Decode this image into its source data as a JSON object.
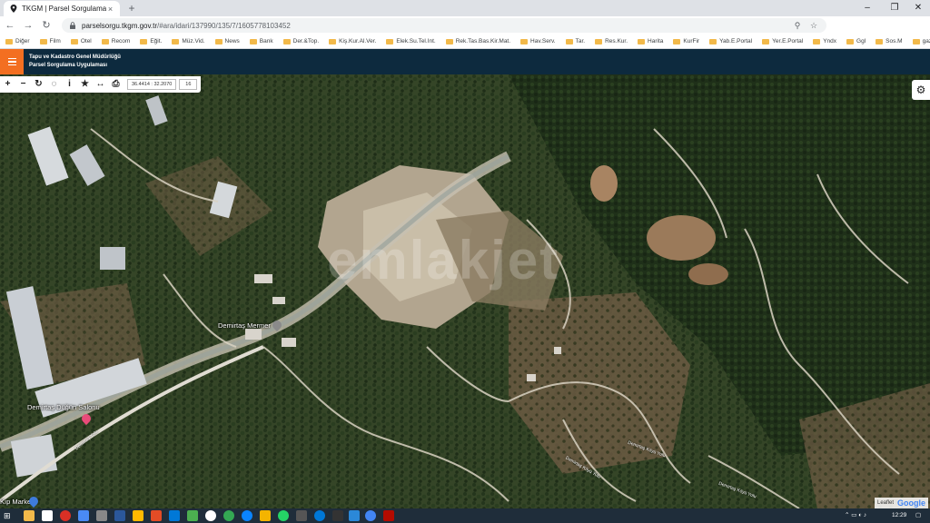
{
  "browser": {
    "tab_title": "TKGM | Parsel Sorgulama Uygula",
    "url_host": "parselsorgu.tkgm.gov.tr",
    "url_path": "/#ara/idari/137990/135/7/1605778103452",
    "bookmarks": [
      "Diğer",
      "Film",
      "Otel",
      "Recom",
      "Eğit.",
      "Müz.Vid.",
      "News",
      "Bank",
      "Der.&Top.",
      "Kiş.Kur.Al.Ver.",
      "Elek.Su.Tel.Int.",
      "Rek.Tas.Bas.Kir.Mat.",
      "Hav.Serv.",
      "Tar.",
      "Res.Kur.",
      "Harita",
      "KurFir",
      "Yab.E.Portal",
      "Yer.E.Portal",
      "Yndx",
      "Ggl",
      "Sos.M",
      "gazivisor"
    ]
  },
  "app": {
    "title_line1": "Tapu ve Kadastro Genel Müdürlüğü",
    "title_line2": "Parsel Sorgulama Uygulaması"
  },
  "map_toolbar": {
    "coordinates": "36.4414 : 32.2070",
    "zoom": "16"
  },
  "map": {
    "watermark": "emlakjet",
    "labels": {
      "mermer": "Demirtaş Mermer",
      "dugun": "Demirtaş Düğün Salonu",
      "market": "Kıp Market"
    },
    "road_labels": [
      "Demirtaş Yolu",
      "Demirtaş Köyü Yolu",
      "Demirtaş Köyü Yolu",
      "Demirtaş Köyü Yolu"
    ],
    "attribution_leaflet": "Leaflet",
    "attribution_google": "Google"
  },
  "taskbar": {
    "time": "12:29"
  },
  "colors": {
    "app_header": "#0d2a3e",
    "menu_accent": "#f36f21"
  }
}
